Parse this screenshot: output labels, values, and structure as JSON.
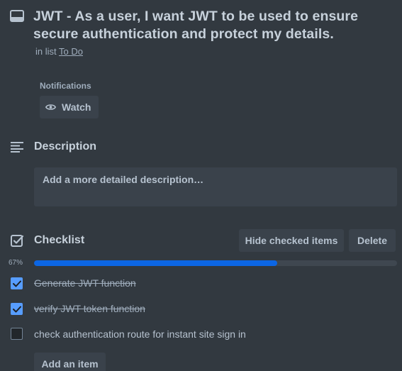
{
  "card": {
    "title": "JWT - As a user, I want JWT to be used to ensure secure authentication and protect my details.",
    "in_list_prefix": "in list",
    "list_name": "To Do"
  },
  "notifications": {
    "label": "Notifications",
    "watch_label": "Watch"
  },
  "description": {
    "heading": "Description",
    "placeholder": "Add a more detailed description…"
  },
  "checklist": {
    "heading": "Checklist",
    "hide_checked_label": "Hide checked items",
    "delete_label": "Delete",
    "progress_text": "67%",
    "progress_fraction": 0.67,
    "progress_color": "#0c66e4",
    "items": [
      {
        "label": "Generate JWT function",
        "checked": true
      },
      {
        "label": "verify JWT token function",
        "checked": true
      },
      {
        "label": "check authentication route for instant site sign in",
        "checked": false
      }
    ],
    "add_item_label": "Add an item"
  },
  "icons": {
    "card": "card-icon",
    "watch": "eye-icon",
    "description": "description-lines-icon",
    "checklist": "checklist-icon",
    "check": "checkmark-icon"
  }
}
